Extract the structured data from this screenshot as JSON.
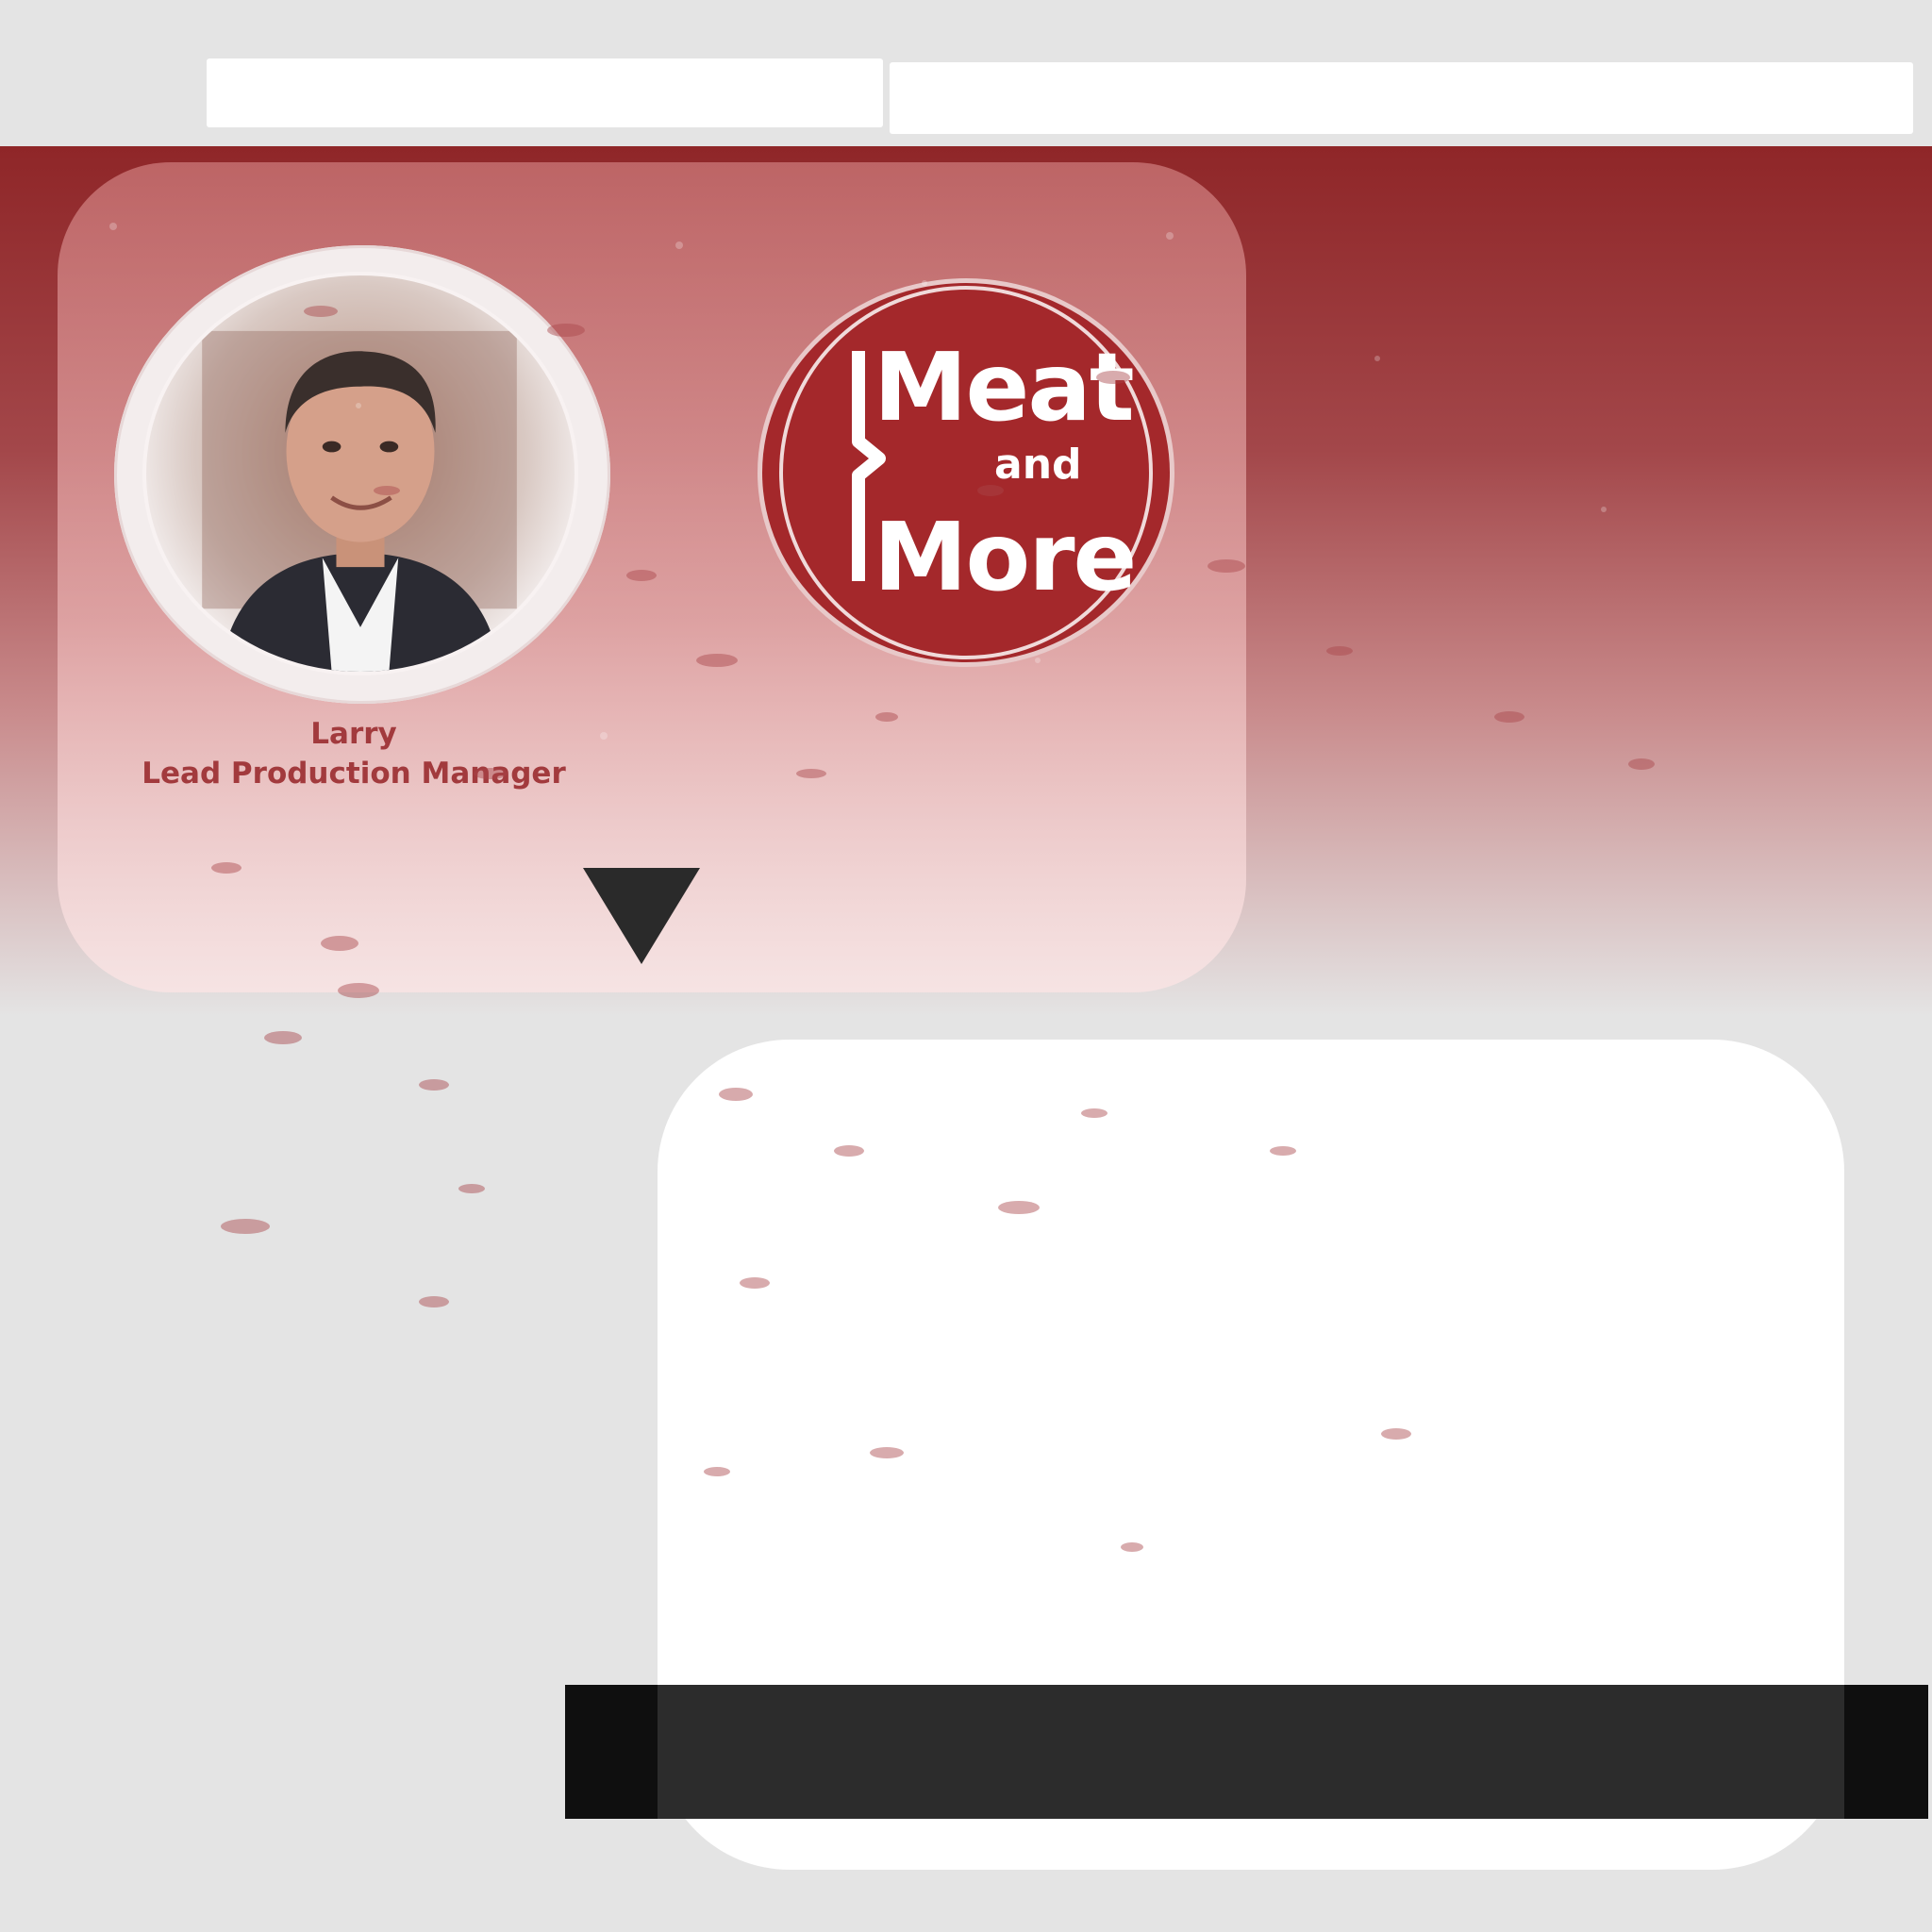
{
  "profile": {
    "name": "Larry",
    "role": "Lead Production Manager"
  },
  "logo": {
    "line1": "Meat",
    "line2": "and",
    "line3": "More"
  },
  "colors": {
    "banner_red": "#8f2628",
    "logo_red": "#a4282b",
    "text_red": "#a23a3d",
    "background": "#e4e4e4",
    "bar": "#0f0f0f"
  },
  "icons": {
    "expand": "triangle-down-icon"
  }
}
